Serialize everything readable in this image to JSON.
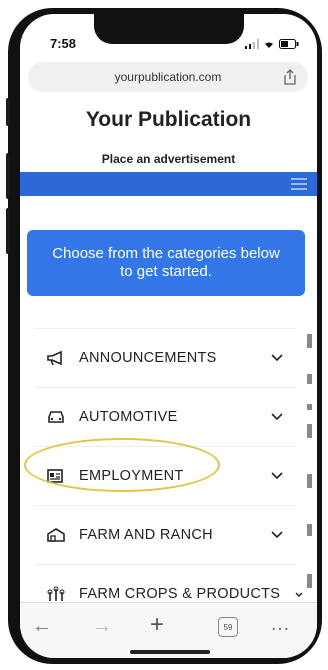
{
  "status": {
    "time": "7:58"
  },
  "browser": {
    "url": "yourpublication.com",
    "tabs_count": "59"
  },
  "page": {
    "title": "Your Publication",
    "subtitle": "Place an advertisement",
    "cta_text": "Choose from the categories below to get started."
  },
  "categories": [
    {
      "label": "ANNOUNCEMENTS",
      "icon": "megaphone-icon"
    },
    {
      "label": "AUTOMOTIVE",
      "icon": "car-icon"
    },
    {
      "label": "EMPLOYMENT",
      "icon": "id-card-icon"
    },
    {
      "label": "FARM AND RANCH",
      "icon": "barn-icon"
    },
    {
      "label": "FARM CROPS & PRODUCTS",
      "icon": "crops-icon"
    }
  ],
  "colors": {
    "nav": "#2d68d8",
    "cta": "#3377e6",
    "highlight": "#e1c64c"
  }
}
